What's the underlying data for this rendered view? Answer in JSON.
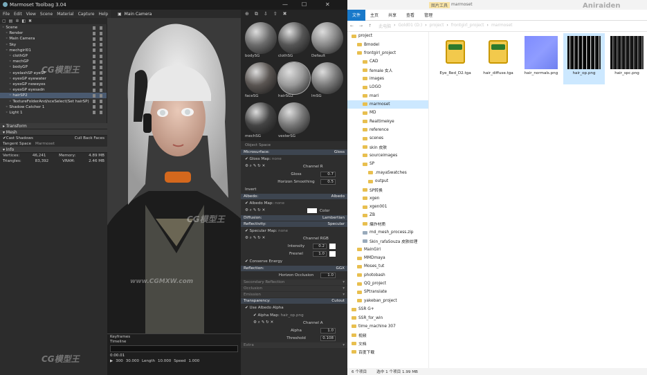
{
  "marmoset": {
    "title": "Marmoset Toolbag 3.04",
    "menu": [
      "File",
      "Edit",
      "View",
      "Scene",
      "Material",
      "Capture",
      "Help"
    ],
    "viewport_camera": "Main Camera",
    "scene_tree": [
      {
        "label": "Scene",
        "indent": 0
      },
      {
        "label": "Render",
        "indent": 1
      },
      {
        "label": "Main Camera",
        "indent": 1
      },
      {
        "label": "Sky",
        "indent": 1
      },
      {
        "label": "mechgirl01",
        "indent": 1
      },
      {
        "label": "clothGP",
        "indent": 2
      },
      {
        "label": "mechGP",
        "indent": 2
      },
      {
        "label": "bodyGP",
        "indent": 2
      },
      {
        "label": "eyelashSP eyeSP",
        "indent": 2
      },
      {
        "label": "eyesGP eyewater",
        "indent": 2
      },
      {
        "label": "eyesGP neweyes",
        "indent": 2
      },
      {
        "label": "eyesGP eyesadn",
        "indent": 2
      },
      {
        "label": "hairSP2",
        "indent": 2,
        "selected": true
      },
      {
        "label": "TextureFolderAnd/sceSelect(Set hairSP)",
        "indent": 2
      },
      {
        "label": "Shadow Catcher 1",
        "indent": 1
      },
      {
        "label": "Light 1",
        "indent": 1
      }
    ],
    "transform_label": "Transform",
    "mesh_label": "Mesh",
    "cast_shadows": "Cast Shadows",
    "cull_back_faces": "Cull Back Faces",
    "tangent_space_label": "Tangent Space",
    "tangent_space_value": "Marmoset",
    "info_label": "Info",
    "vertices_label": "Vertices:",
    "vertices_value": "46,241",
    "triangles_label": "Triangles:",
    "triangles_value": "83,392",
    "memory_label": "Memory:",
    "memory_value": "4.89 MB",
    "vram_label": "VRAM:",
    "vram_value": "2.46 MB",
    "materials": [
      {
        "label": "bodySG",
        "color": "#6b6b6b"
      },
      {
        "label": "clothSG",
        "color": "#555"
      },
      {
        "label": "Default",
        "color": "#888"
      },
      {
        "label": "faceSG",
        "color": "#5a5552"
      },
      {
        "label": "hairSG2",
        "color": "#9a9a9a"
      },
      {
        "label": "lmSG",
        "color": "#7a7a7a"
      },
      {
        "label": "mechSG",
        "color": "#444"
      },
      {
        "label": "vesterSG",
        "color": "#777"
      }
    ],
    "props": {
      "object_space": "Object Space",
      "microsurface": "Microsurface:",
      "microsurface_value": "Gloss",
      "gloss_map": "Gloss Map:",
      "gloss_map_value": "none",
      "channel": "Channel",
      "channel_value": "R",
      "gloss_label": "Gloss",
      "gloss_value": "0.7",
      "horizon_smoothing": "Horizon Smoothing",
      "horizon_smoothing_value": "0.5",
      "invert": "Invert",
      "albedo": "Albedo:",
      "albedo_value": "Albedo",
      "albedo_map": "Albedo Map:",
      "albedo_map_value": "none",
      "color_label": "Color",
      "diffusion": "Diffusion:",
      "diffusion_value": "Lambertian",
      "reflectivity": "Reflectivity:",
      "reflectivity_value": "Specular",
      "specular_map": "Specular Map:",
      "specular_map_value": "none",
      "channel_rgb": "RGB",
      "intensity": "Intensity",
      "intensity_value": "0.2",
      "fresnel": "Fresnel",
      "fresnel_value": "1.0",
      "conserve_energy": "Conserve Energy",
      "reflection": "Reflection:",
      "reflection_value": "GGX",
      "horizon_occlusion": "Horizon Occlusion",
      "horizon_occlusion_value": "1.0",
      "secondary_reflection": "Secondary Reflection",
      "occlusion": "Occlusion",
      "emission": "Emission",
      "transparency": "Transparency:",
      "transparency_value": "Cutout",
      "use_albedo_alpha": "Use Albedo Alpha",
      "alpha_map": "Alpha Map:",
      "alpha_map_value": "hair_op.png",
      "channel_a": "A",
      "alpha_label": "Alpha",
      "alpha_value": "1.0",
      "threshold_label": "Threshold",
      "threshold_value": "0.108",
      "extra": "Extra"
    },
    "timeline": {
      "keyframes": "Keyframes",
      "timeline_label": "Timeline",
      "time_value": "0:00.01",
      "frame_value": "300",
      "fps_value": "30.000",
      "length_label": "Length",
      "length_value": "10.000",
      "speed_label": "Speed",
      "speed_value": "1.000"
    }
  },
  "explorer": {
    "title": "marmoset",
    "ribbon_context": "图片工具",
    "tabs": [
      "文件",
      "主页",
      "共享",
      "查看",
      "管理"
    ],
    "path": [
      "此电脑",
      "Gold01 (D:)",
      "project",
      "frontgirl_project",
      "marmoset"
    ],
    "tree": [
      {
        "label": "project",
        "indent": 0
      },
      {
        "label": "Bmodel",
        "indent": 1
      },
      {
        "label": "frontgirl_project",
        "indent": 1
      },
      {
        "label": "CAD",
        "indent": 2
      },
      {
        "label": "female 女人",
        "indent": 2
      },
      {
        "label": "images",
        "indent": 2
      },
      {
        "label": "LOGO",
        "indent": 2
      },
      {
        "label": "mari",
        "indent": 2
      },
      {
        "label": "marmoset",
        "indent": 2,
        "selected": true
      },
      {
        "label": "MD",
        "indent": 2
      },
      {
        "label": "Realtimekye",
        "indent": 2
      },
      {
        "label": "reference",
        "indent": 2
      },
      {
        "label": "scenes",
        "indent": 2
      },
      {
        "label": "skin 皮肤",
        "indent": 2
      },
      {
        "label": "sourceimages",
        "indent": 2
      },
      {
        "label": "SP",
        "indent": 2
      },
      {
        "label": ".mayaSwatches",
        "indent": 3
      },
      {
        "label": "output",
        "indent": 3
      },
      {
        "label": "SP转换",
        "indent": 2
      },
      {
        "label": "xgen",
        "indent": 2
      },
      {
        "label": "xgen001",
        "indent": 2
      },
      {
        "label": "ZB",
        "indent": 2
      },
      {
        "label": "爆炸材质",
        "indent": 2
      },
      {
        "label": "md_mesh_process.zip",
        "indent": 2,
        "file": true
      },
      {
        "label": "Skin_rafaSouza 皮肤纹理",
        "indent": 2,
        "file": true
      },
      {
        "label": "MainGirl",
        "indent": 1
      },
      {
        "label": "MMDmaya",
        "indent": 1
      },
      {
        "label": "Moses_tut",
        "indent": 1
      },
      {
        "label": "photobash",
        "indent": 1
      },
      {
        "label": "QQ_project",
        "indent": 1
      },
      {
        "label": "SPtranslate",
        "indent": 1
      },
      {
        "label": "yakeban_project",
        "indent": 1
      },
      {
        "label": "SSR G+",
        "indent": 0
      },
      {
        "label": "SSR_for_win",
        "indent": 0
      },
      {
        "label": "time_machine 307",
        "indent": 0
      },
      {
        "label": "视频",
        "indent": 0
      },
      {
        "label": "文档",
        "indent": 0
      },
      {
        "label": "百度下载",
        "indent": 0
      }
    ],
    "files": [
      {
        "name": "Eye_Red_D2.tga",
        "kind": "tga"
      },
      {
        "name": "hair_diffuse.tga",
        "kind": "tga"
      },
      {
        "name": "hair_normals.png",
        "kind": "normal"
      },
      {
        "name": "hair_op.png",
        "kind": "opacity",
        "selected": true
      },
      {
        "name": "hair_spc.png",
        "kind": "spec"
      }
    ],
    "status_count": "6 个项目",
    "status_selected": "选中 1 个项目  1.99 MB"
  },
  "watermarks": {
    "cg": "CG模型王",
    "url": "www.CGMXW.com",
    "author": "Aniraiden"
  }
}
